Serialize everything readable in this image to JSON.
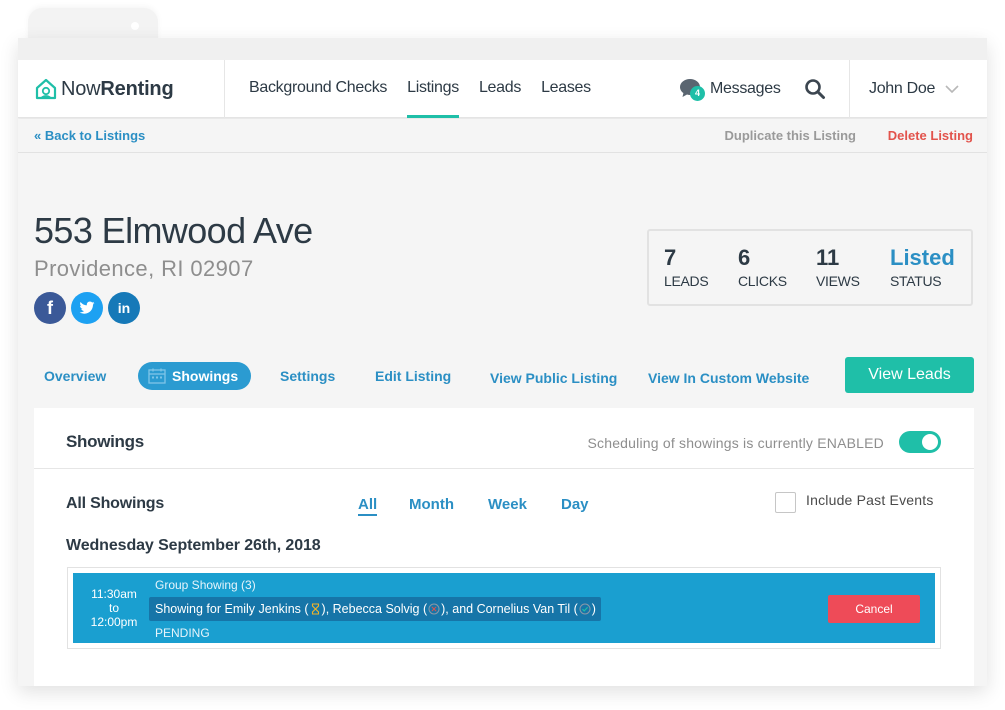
{
  "app": {
    "brand_first": "Now",
    "brand_second": "Renting"
  },
  "nav": {
    "items": [
      {
        "label": "Background Checks",
        "active": false
      },
      {
        "label": "Listings",
        "active": true
      },
      {
        "label": "Leads",
        "active": false
      },
      {
        "label": "Leases",
        "active": false
      }
    ],
    "messages_label": "Messages",
    "messages_count": "4",
    "user_name": "John Doe"
  },
  "subbar": {
    "back_label": "« Back to Listings",
    "duplicate_label": "Duplicate this Listing",
    "delete_label": "Delete Listing"
  },
  "listing": {
    "address": "553 Elmwood Ave",
    "city": "Providence, RI 02907",
    "stats": [
      {
        "value": "7",
        "label": "LEADS"
      },
      {
        "value": "6",
        "label": "CLICKS"
      },
      {
        "value": "11",
        "label": "VIEWS"
      },
      {
        "value": "Listed",
        "label": "STATUS"
      }
    ]
  },
  "subnav": {
    "overview": "Overview",
    "showings": "Showings",
    "settings": "Settings",
    "edit_listing": "Edit Listing",
    "view_public": "View Public Listing",
    "view_custom": "View In Custom Website",
    "view_leads": "View Leads"
  },
  "showings": {
    "title": "Showings",
    "scheduling_text": "Scheduling of showings is currently ENABLED",
    "scheduling_enabled": true,
    "all_label": "All Showings",
    "filters": [
      "All",
      "Month",
      "Week",
      "Day"
    ],
    "active_filter": "All",
    "include_past_label": "Include Past Events",
    "include_past_checked": false,
    "date_heading": "Wednesday September 26th, 2018",
    "event": {
      "time_start": "11:30am",
      "time_to": "to",
      "time_end": "12:00pm",
      "group": "Group Showing (3)",
      "names_prefix": "Showing for Emily Jenkins (",
      "names_mid1": "), Rebecca Solvig (",
      "names_mid2": "), and Cornelius Van Til (",
      "names_suffix": ")",
      "status": "PENDING",
      "cancel_label": "Cancel"
    }
  },
  "colors": {
    "accent_teal": "#1fbfa8",
    "link_blue": "#2b8fc4",
    "event_blue": "#1a9fd0",
    "danger_red": "#e2534c"
  }
}
